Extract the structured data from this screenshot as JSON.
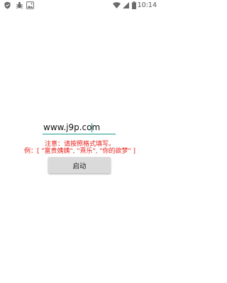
{
  "status_bar": {
    "left_icons": [
      "shield-icon",
      "bug-icon",
      "image-icon"
    ],
    "right_icons": [
      "wifi-icon",
      "signal-icon",
      "battery-icon"
    ],
    "time": "10:14"
  },
  "form": {
    "url_value": "www.j9p.com",
    "note": "注意：请按照格式填写。",
    "example": "例：[ \"富贵姨姨\", \"熹乐\", \"你的欲梦\" ]",
    "start_button_label": "启动"
  },
  "colors": {
    "accent": "#1a9b8e",
    "warning_text": "#e8201c",
    "button_bg": "#dadada"
  }
}
